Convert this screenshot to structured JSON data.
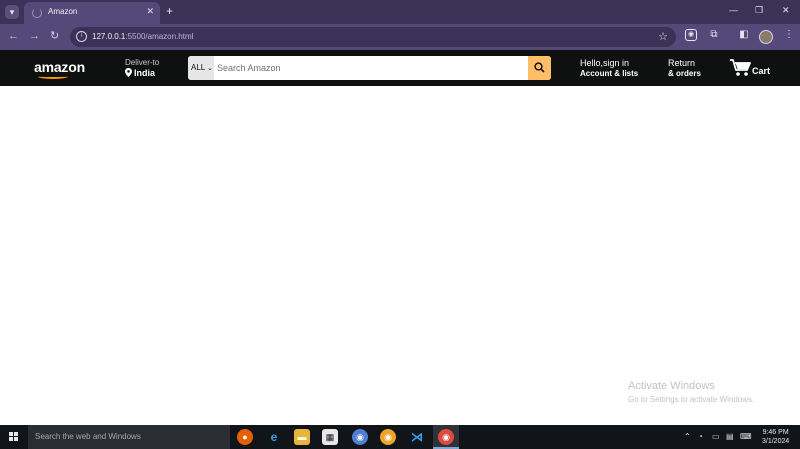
{
  "browser": {
    "tab_title": "Amazon",
    "tab_close": "✕",
    "new_tab": "+",
    "url_host": "127.0.0.1",
    "url_rest": ":5500/amazon.html",
    "window_controls": [
      "—",
      "❐",
      "✕"
    ],
    "icons": [
      "tab-search-icon",
      "back-icon",
      "forward-icon",
      "reload-icon",
      "site-info-icon",
      "bookmark-star-icon",
      "extension-icon",
      "puzzle-icon",
      "side-panel-icon",
      "profile-avatar",
      "more-menu-icon"
    ]
  },
  "navbar": {
    "logo": "amazon",
    "deliver_label": "Deliver-to",
    "deliver_location": "India",
    "search_category": "ALL",
    "search_placeholder": "Search Amazon",
    "account_line1": "Hello,sign in",
    "account_line2": "Account & lists",
    "returns_line1": "Return",
    "returns_line2": "& orders",
    "cart_label": "Cart",
    "accent_color": "#febd69",
    "bg_color": "#0f1111"
  },
  "watermark": {
    "line1": "Activate Windows",
    "line2": "Go to Settings to activate Windows."
  },
  "taskbar": {
    "search_placeholder": "Search the web and Windows",
    "time": "9:46 PM",
    "date": "3/1/2024",
    "apps": [
      "firefox-icon",
      "edge-icon",
      "file-explorer-icon",
      "store-icon",
      "chrome-icon-2",
      "chrome-canary-icon",
      "vscode-icon",
      "chrome-icon"
    ]
  }
}
